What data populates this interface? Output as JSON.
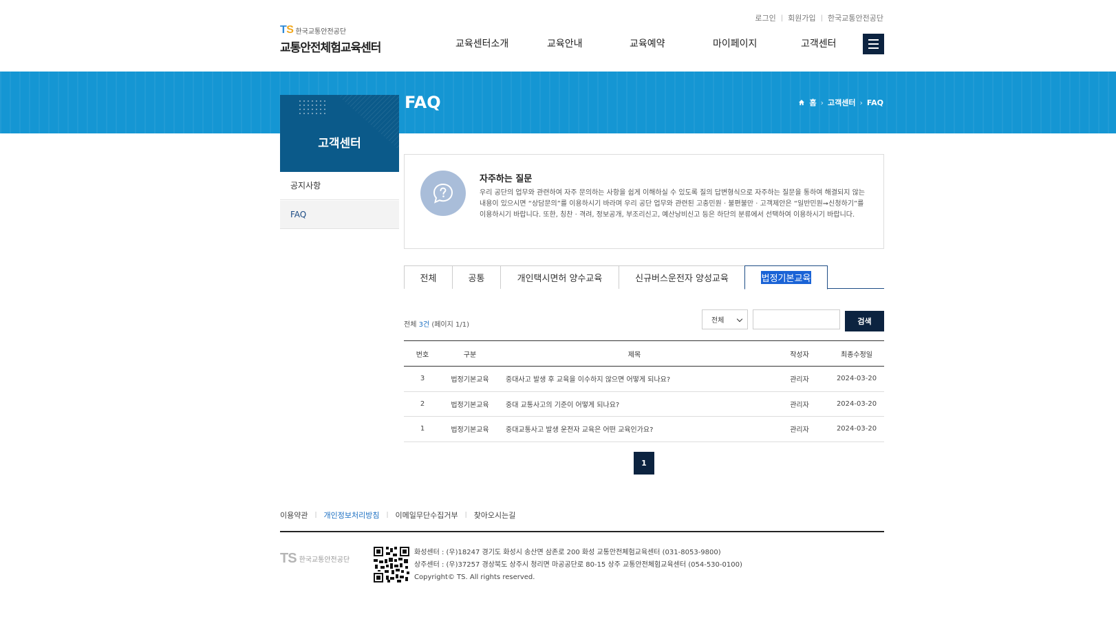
{
  "header": {
    "top_links": [
      "로그인",
      "회원가입",
      "한국교통안전공단"
    ],
    "logo": {
      "ts_t": "T",
      "ts_s": "S",
      "org": "한국교통안전공단",
      "name": "교통안전체험교육센터"
    },
    "nav": [
      "교육센터소개",
      "교육안내",
      "교육예약",
      "마이페이지",
      "고객센터"
    ]
  },
  "banner": {
    "title": "FAQ",
    "breadcrumb": [
      "홈",
      "고객센터",
      "FAQ"
    ]
  },
  "lnb": {
    "title": "고객센터",
    "items": [
      {
        "label": "공지사항",
        "active": false
      },
      {
        "label": "FAQ",
        "active": true
      }
    ]
  },
  "intro": {
    "heading": "자주하는 질문",
    "description": "우리 공단의 업무와 관련하여 자주 문의하는 사항을 쉽게 이해하실 수 있도록 질의 답변형식으로 자주하는 질문을 통하여 해결되지 않는 내용이 있으시면 “상담문의”를 이용하시기 바라며 우리 공단 업무와 관련된 고충민원 · 불편불만 · 고객제안은 “일반민원➞신청하기”를 이용하시기 바랍니다. 또한, 칭찬 · 격려, 정보공개, 부조리신고, 예산낭비신고 등은 하단의 분류에서 선택하여 이용하시기 바랍니다."
  },
  "tabs": [
    {
      "label": "전체",
      "active": false
    },
    {
      "label": "공통",
      "active": false
    },
    {
      "label": "개인택시면허 양수교육",
      "active": false
    },
    {
      "label": "신규버스운전자 양성교육",
      "active": false
    },
    {
      "label": "법정기본교육",
      "active": true
    }
  ],
  "list": {
    "total_prefix": "전체 ",
    "total_count": "3건",
    "page_info": " (페이지 1/1)",
    "select_value": "전체",
    "search_button": "검색",
    "columns": [
      "번호",
      "구분",
      "제목",
      "작성자",
      "최종수정일"
    ],
    "rows": [
      {
        "no": "3",
        "category": "법정기본교육",
        "title": "중대사고 발생 후 교육을 이수하지 않으면 어떻게 되나요?",
        "author": "관리자",
        "date": "2024-03-20"
      },
      {
        "no": "2",
        "category": "법정기본교육",
        "title": "중대 교통사고의 기준이 어떻게 되나요?",
        "author": "관리자",
        "date": "2024-03-20"
      },
      {
        "no": "1",
        "category": "법정기본교육",
        "title": "중대교통사고 발생 운전자 교육은 어떤 교육인가요?",
        "author": "관리자",
        "date": "2024-03-20"
      }
    ],
    "current_page": "1"
  },
  "footer": {
    "links": [
      "이용약관",
      "개인정보처리방침",
      "이메일무단수집거부",
      "찾아오시는길"
    ],
    "logo_ts": "TS",
    "logo_org": "한국교통안전공단",
    "address_lines": [
      "화성센터 : (우)18247 경기도 화성시 송산면 삼존로 200 화성 교통안전체험교육센터 (031-8053-9800)",
      "상주센터 : (우)37257 경상북도 상주시 청리면 마공공단로 80-15 상주 교통안전체험교육센터 (054-530-0100)",
      "Copyright© TS. All rights reserved."
    ]
  },
  "colors": {
    "banner": "#1596d3",
    "navy": "#0c2340",
    "lnb_head": "#0b5a8a",
    "accent_text": "#1b6fc2"
  }
}
